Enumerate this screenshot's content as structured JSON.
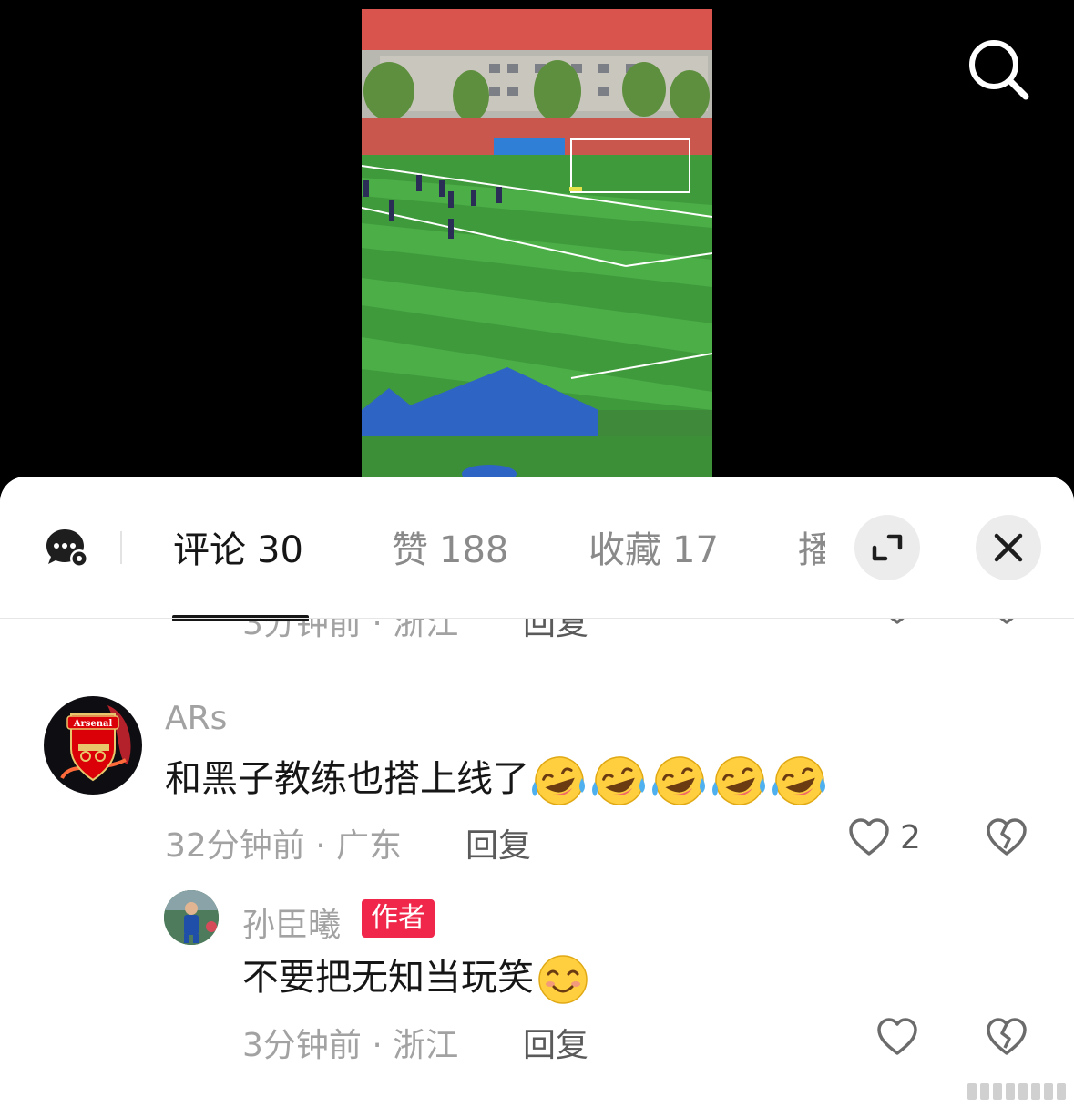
{
  "tabs": {
    "comments": {
      "label": "评论",
      "count": "30"
    },
    "likes": {
      "label": "赞",
      "count": "188"
    },
    "favorites": {
      "label": "收藏",
      "count": "17"
    },
    "more": {
      "label": "播"
    }
  },
  "partial_comment": {
    "time": "3分钟前 · 浙江",
    "reply": "回复"
  },
  "comments": [
    {
      "username": "ARs",
      "avatar_text": "Arsenal",
      "text": "和黑子教练也搭上线了",
      "emoji": "laughing-crying-face",
      "emoji_count": 5,
      "time": "32分钟前 · 广东",
      "reply": "回复",
      "likes": "2",
      "replies": [
        {
          "username": "孙臣曦",
          "badge": "作者",
          "text": "不要把无知当玩笑",
          "emoji": "blushing-smile-face",
          "time": "3分钟前 · 浙江",
          "reply": "回复"
        }
      ]
    }
  ],
  "colors": {
    "author_badge": "#f0264b",
    "text_primary": "#161616",
    "text_secondary": "#a2a2a2"
  }
}
